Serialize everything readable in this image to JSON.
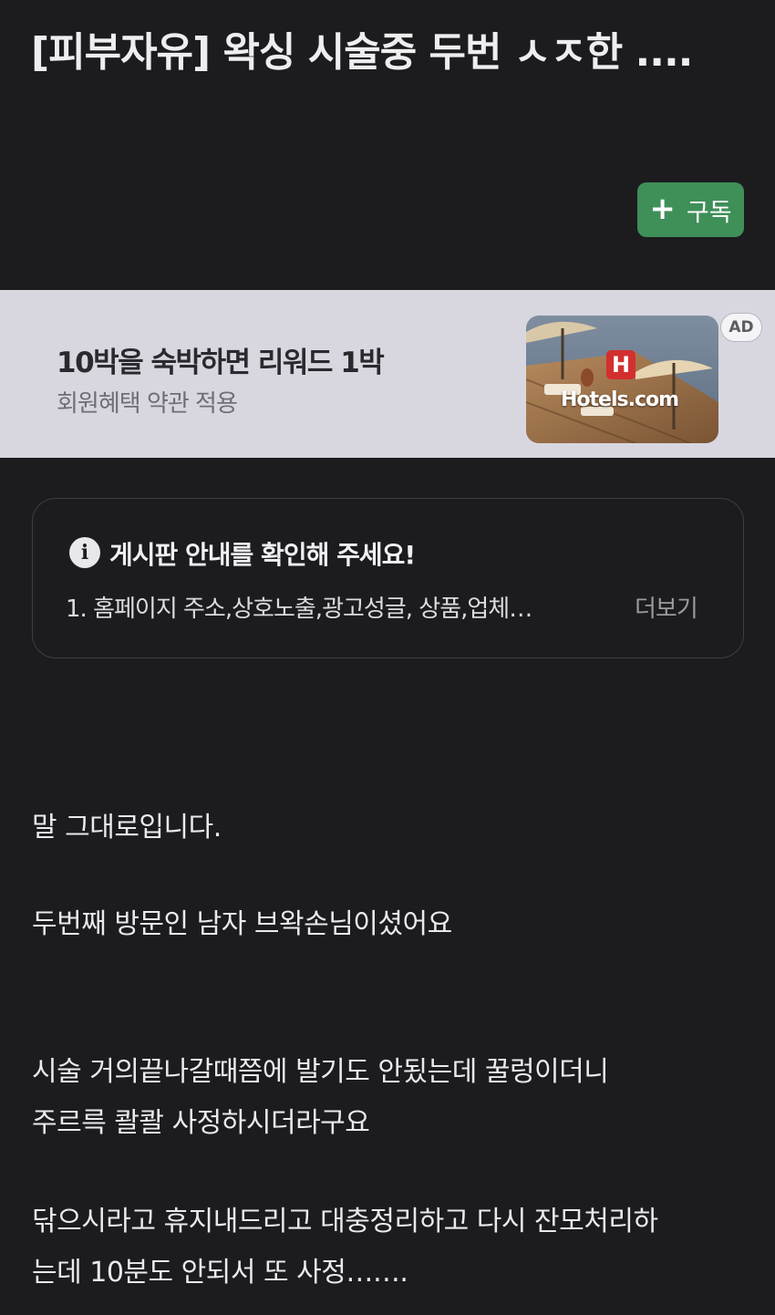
{
  "post": {
    "title": "[피부자유] 왁싱 시술중 두번 ㅅㅈ한 ....",
    "subscribe_label": "구독",
    "subscribe_icon": "plus-icon"
  },
  "ad": {
    "headline": "10박을 숙박하면 리워드 1박",
    "sub": "회원혜택 약관 적용",
    "brand": "Hotels.com",
    "brand_mark": "H",
    "badge": "AD"
  },
  "notice": {
    "title": "게시판 안내를 확인해 주세요!",
    "body": "1. 홈페이지 주소,상호노출,광고성글, 상품,업체…",
    "more": "더보기",
    "icon": "info-icon"
  },
  "content": {
    "paragraphs": [
      "말 그대로입니다.",
      "두번째 방문인 남자 브왁손님이셨어요",
      "시술 거의끝나갈때쯤에 발기도 안됬는데 꿀렁이더니",
      "주르륵 콸콸 사정하시더라구요",
      "닦으시라고 휴지내드리고 대충정리하고 다시 잔모처리하",
      "는데 10분도 안되서 또 사정……."
    ]
  },
  "colors": {
    "background": "#1c1c1e",
    "subscribe_button": "#3f8f58",
    "ad_background": "#d8d7e0",
    "hotels_red": "#d32f2f"
  }
}
